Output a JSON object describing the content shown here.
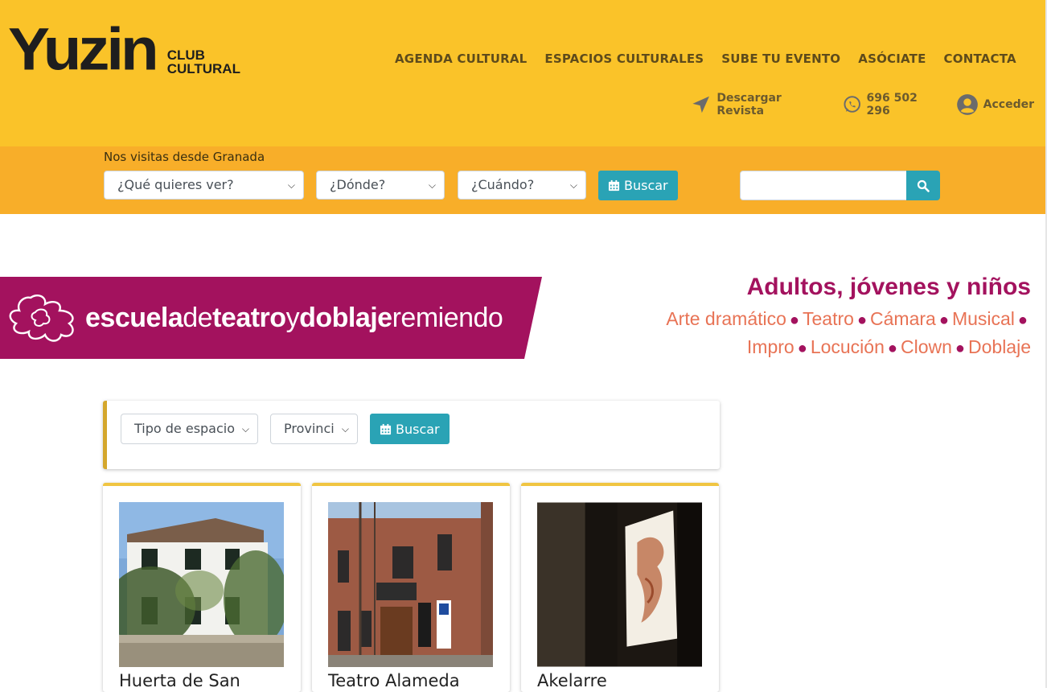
{
  "brand": {
    "name": "Yuzin",
    "sub_line1": "CLUB",
    "sub_line2": "CULTURAL"
  },
  "nav": {
    "items": [
      {
        "label": "AGENDA CULTURAL"
      },
      {
        "label": "ESPACIOS CULTURALES"
      },
      {
        "label": "SUBE TU EVENTO"
      },
      {
        "label": "ASÓCIATE"
      },
      {
        "label": "CONTACTA"
      }
    ]
  },
  "utility": {
    "download": "Descargar Revista",
    "phone": "696 502 296",
    "login": "Acceder"
  },
  "search": {
    "location_label": "Nos visitas desde Granada",
    "what": "¿Qué quieres ver?",
    "where": "¿Dónde?",
    "when": "¿Cuándo?",
    "button": "Buscar",
    "text_value": ""
  },
  "banner": {
    "school_part1": "escuela",
    "school_part2": "de",
    "school_part3": "teatro",
    "school_part4": "y",
    "school_part5": "doblaje",
    "school_part6": "remiendo",
    "headline": "Adultos, jóvenes y niños",
    "line1": [
      "Arte dramático",
      "Teatro",
      "Cámara",
      "Musical"
    ],
    "line2": [
      "Impro",
      "Locución",
      "Clown",
      "Doblaje"
    ],
    "colors": {
      "magenta": "#a3125e",
      "salmon": "#e87355"
    }
  },
  "filters": {
    "type": "Tipo de espacio",
    "province": "Provinci",
    "button": "Buscar"
  },
  "cards": [
    {
      "title": "Huerta de San"
    },
    {
      "title": "Teatro Alameda"
    },
    {
      "title": "Akelarre"
    }
  ],
  "colors": {
    "header_bg": "#fac329",
    "searchbar_bg": "#f8ae29",
    "accent": "#2aa3b5"
  }
}
